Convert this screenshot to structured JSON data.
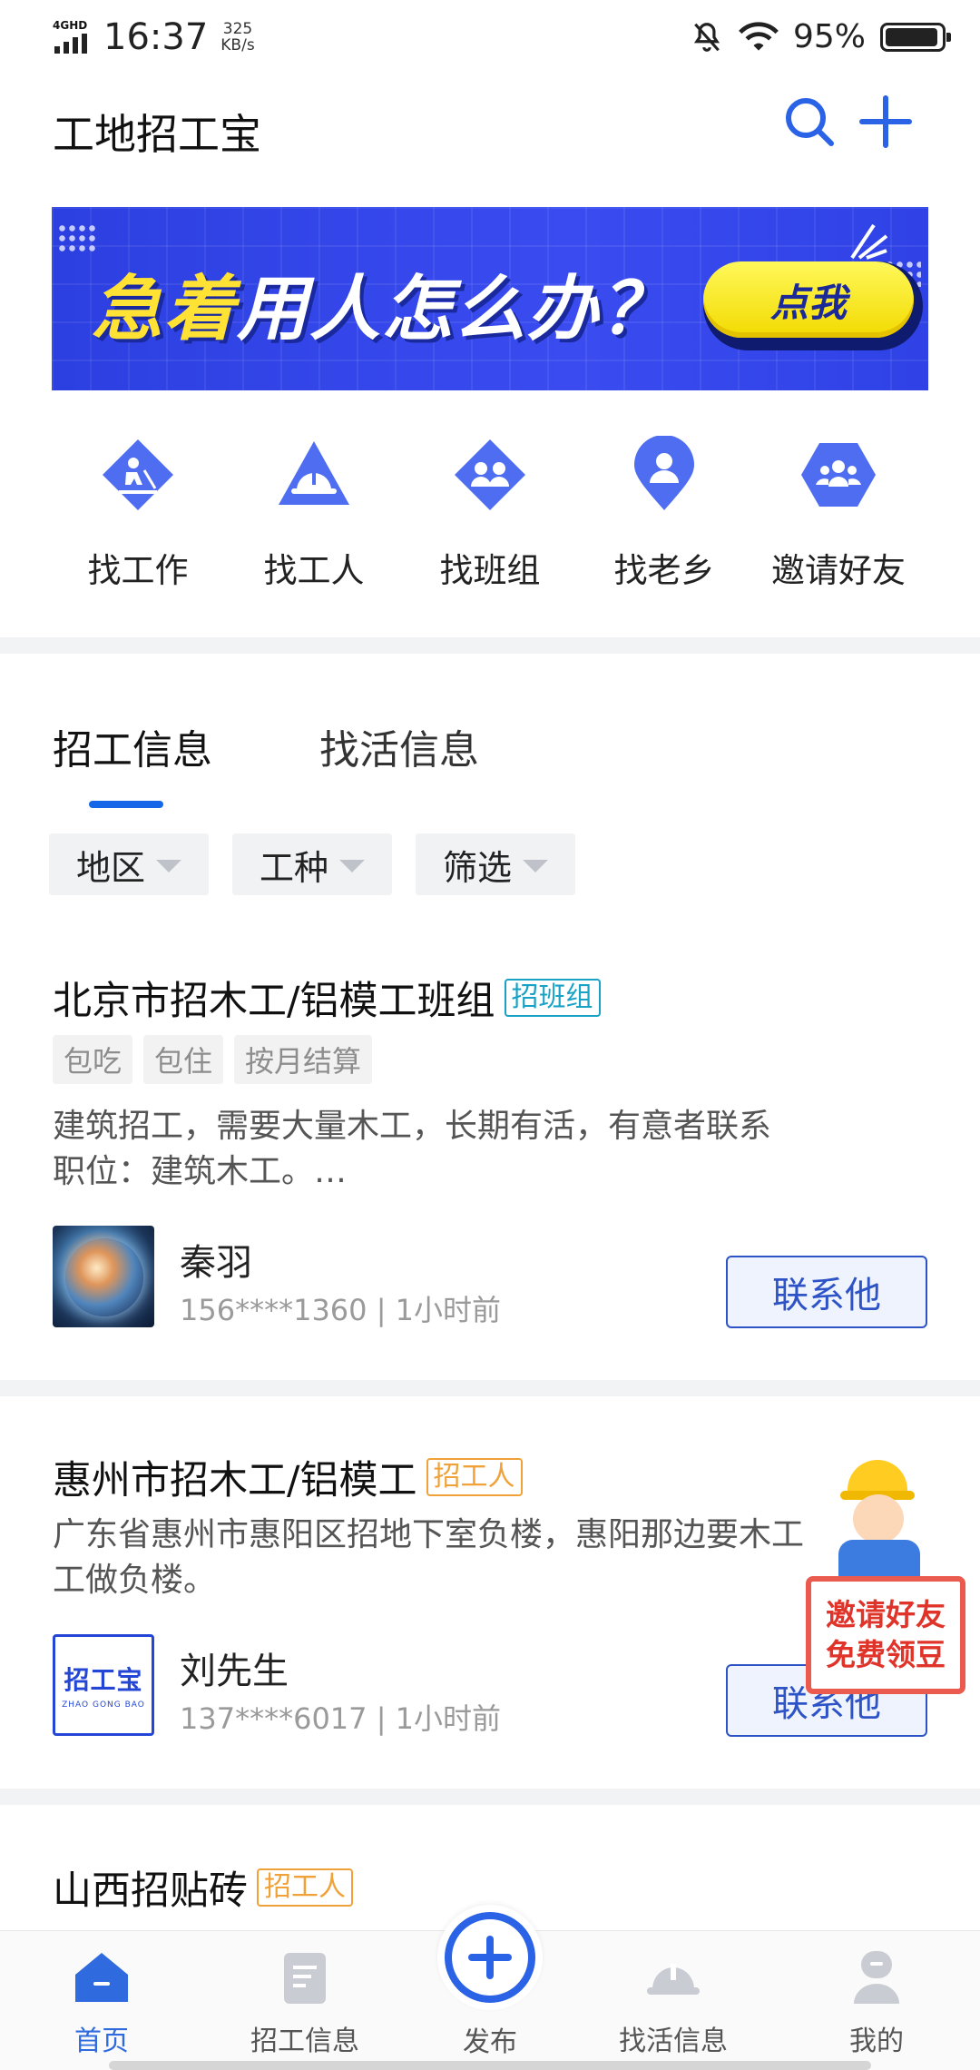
{
  "status_bar": {
    "network": "4GHD",
    "time": "16:37",
    "speed_value": "325",
    "speed_unit": "KB/s",
    "battery": "95%",
    "battery_level": 0.95
  },
  "header": {
    "title": "工地招工宝",
    "search_icon": "search-icon",
    "add_icon": "plus-icon"
  },
  "banner": {
    "text_highlight": "急着",
    "text_rest": "用人怎么办？",
    "button": "点我",
    "colors": {
      "background": "#3a4cf0",
      "highlight": "#ffe234",
      "button": "#fff85a"
    }
  },
  "quick_nav": [
    {
      "label": "找工作",
      "icon": "worker-digging-icon"
    },
    {
      "label": "找工人",
      "icon": "hard-hat-icon"
    },
    {
      "label": "找班组",
      "icon": "team-icon"
    },
    {
      "label": "找老乡",
      "icon": "location-person-icon"
    },
    {
      "label": "邀请好友",
      "icon": "group-icon"
    }
  ],
  "tabs": {
    "active": "招工信息",
    "inactive": "找活信息",
    "accent": "#1667e8"
  },
  "filters": [
    "地区",
    "工种",
    "筛选"
  ],
  "listings": [
    {
      "title": "北京市招木工/铝模工班组",
      "tag": "招班组",
      "chips": [
        "包吃",
        "包住",
        "按月结算"
      ],
      "desc_line1": "建筑招工，需要大量木工，长期有活，有意者联系",
      "desc_line2": "职位：建筑木工。…",
      "name": "秦羽",
      "meta": "156****1360  |  1小时前",
      "button": "联系他"
    },
    {
      "title": "惠州市招木工/铝模工",
      "tag": "招工人",
      "desc_line1": "广东省惠州市惠阳区招地下室负楼，惠阳那边要木工",
      "desc_line2": "工做负楼。",
      "avatar_text": "招工宝",
      "avatar_subtext": "ZHAO GONG BAO",
      "name": "刘先生",
      "meta": "137****6017  |  1小时前",
      "button": "联系他"
    },
    {
      "title": "山西招贴砖",
      "tag": "招工人"
    }
  ],
  "float_badge": {
    "line1": "邀请好友",
    "line2": "免费领豆"
  },
  "bottom_nav": [
    {
      "label": "首页",
      "icon": "home-icon",
      "active": true
    },
    {
      "label": "招工信息",
      "icon": "document-icon",
      "active": false
    },
    {
      "label": "发布",
      "icon": "plus-circle-icon",
      "active": false
    },
    {
      "label": "找活信息",
      "icon": "helmet-icon",
      "active": false
    },
    {
      "label": "我的",
      "icon": "user-icon",
      "active": false
    }
  ]
}
